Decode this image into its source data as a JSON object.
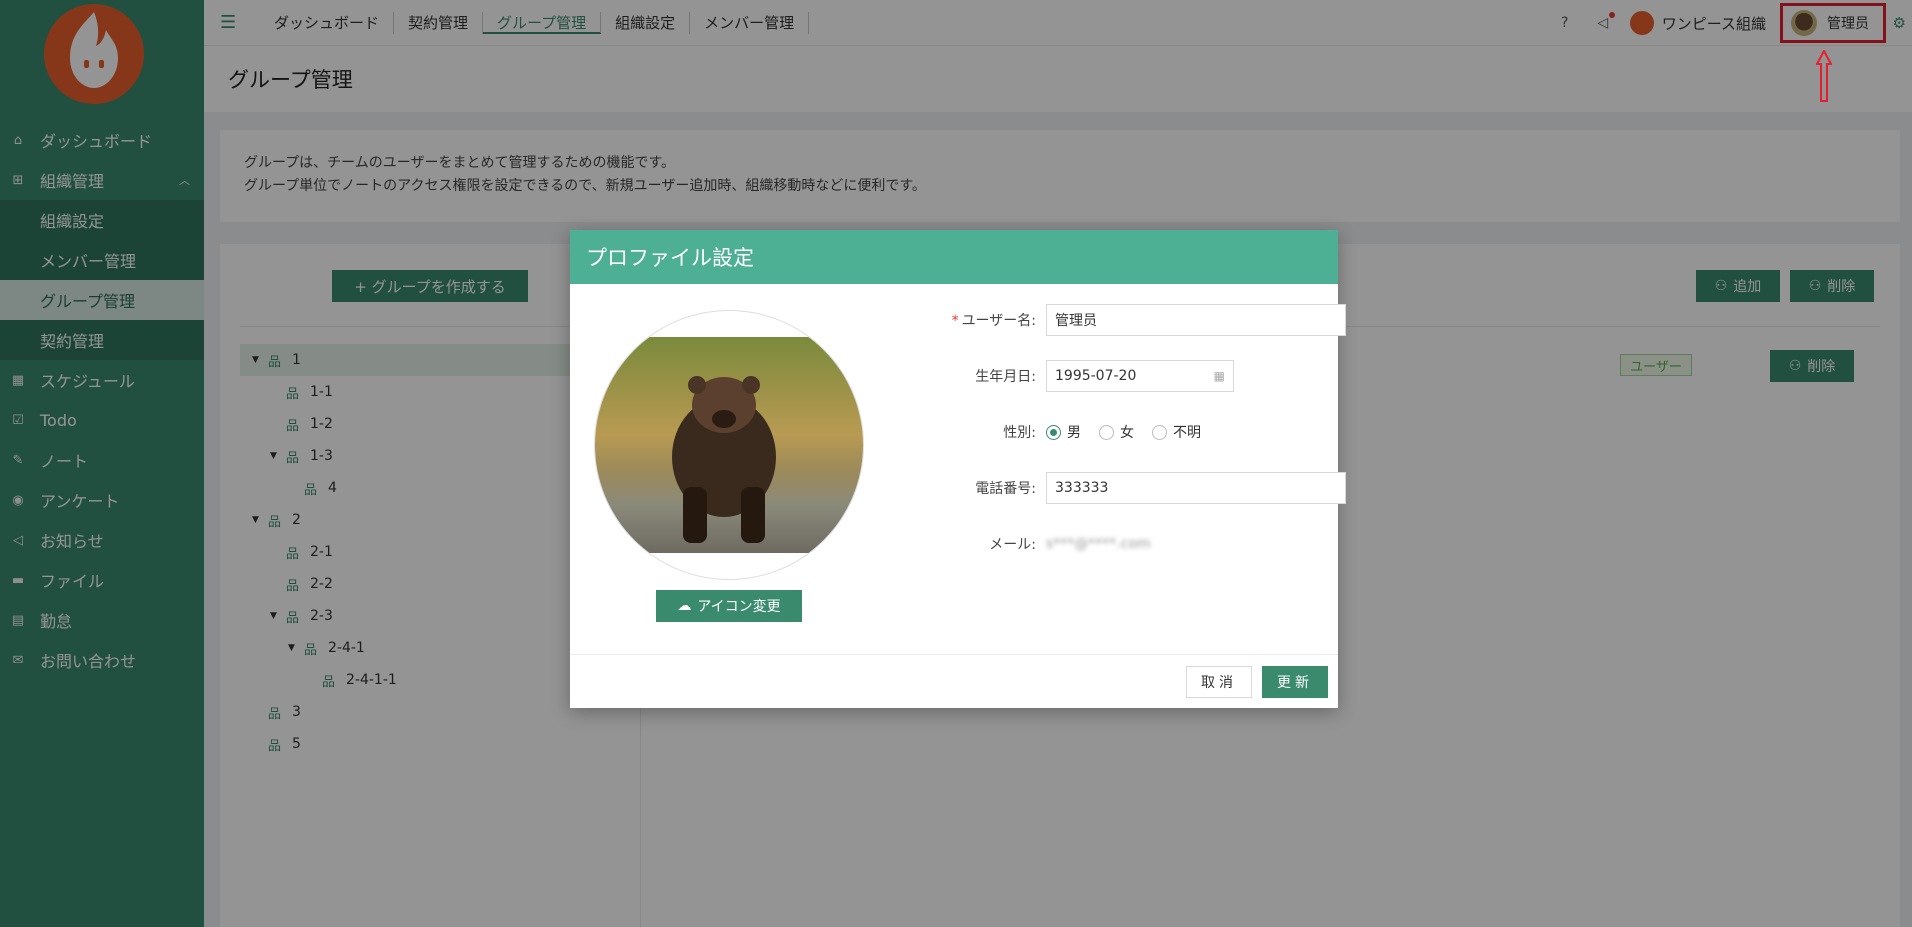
{
  "sidebar": {
    "items": [
      {
        "label": "ダッシュボード",
        "icon": "dashboard-icon"
      },
      {
        "label": "組織管理",
        "icon": "org-icon"
      },
      {
        "label": "組織設定"
      },
      {
        "label": "メンバー管理"
      },
      {
        "label": "グループ管理"
      },
      {
        "label": "契約管理"
      },
      {
        "label": "スケジュール",
        "icon": "calendar-icon"
      },
      {
        "label": "Todo",
        "icon": "todo-icon"
      },
      {
        "label": "ノート",
        "icon": "note-icon"
      },
      {
        "label": "アンケート",
        "icon": "survey-icon"
      },
      {
        "label": "お知らせ",
        "icon": "announce-icon"
      },
      {
        "label": "ファイル",
        "icon": "folder-icon"
      },
      {
        "label": "勤怠",
        "icon": "attendance-icon"
      },
      {
        "label": "お問い合わせ",
        "icon": "inquiry-icon"
      }
    ]
  },
  "header": {
    "tabs": [
      "ダッシュボード",
      "契約管理",
      "グループ管理",
      "組織設定",
      "メンバー管理"
    ],
    "org_name": "ワンピース組織",
    "user_name": "管理员"
  },
  "page": {
    "title": "グループ管理",
    "desc_line1": "グループは、チームのユーザーをまとめて管理するための機能です。",
    "desc_line2": "グループ単位でノートのアクセス権限を設定できるので、新規ユーザー追加時、組織移動時などに便利です。",
    "create_label": "+ グループを作成する",
    "add_label": "追加",
    "delete_label": "削除",
    "user_tag": "ユーザー",
    "row_delete_label": "削除"
  },
  "tree": [
    {
      "label": "1",
      "level": 0,
      "caret": true
    },
    {
      "label": "1-1",
      "level": 1,
      "caret": false
    },
    {
      "label": "1-2",
      "level": 1,
      "caret": false
    },
    {
      "label": "1-3",
      "level": 1,
      "caret": true
    },
    {
      "label": "4",
      "level": 2,
      "caret": false
    },
    {
      "label": "2",
      "level": 0,
      "caret": true
    },
    {
      "label": "2-1",
      "level": 1,
      "caret": false
    },
    {
      "label": "2-2",
      "level": 1,
      "caret": false
    },
    {
      "label": "2-3",
      "level": 1,
      "caret": true
    },
    {
      "label": "2-4-1",
      "level": 2,
      "caret": true
    },
    {
      "label": "2-4-1-1",
      "level": 3,
      "caret": false
    },
    {
      "label": "3",
      "level": 0,
      "caret": false
    },
    {
      "label": "5",
      "level": 0,
      "caret": false
    }
  ],
  "modal": {
    "title": "プロファイル設定",
    "icon_change_label": "アイコン変更",
    "username_label": "ユーザー名:",
    "username_value": "管理员",
    "birthday_label": "生年月日:",
    "birthday_value": "1995-07-20",
    "gender_label": "性別:",
    "gender_options": [
      "男",
      "女",
      "不明"
    ],
    "gender_selected": "男",
    "phone_label": "電話番号:",
    "phone_value": "333333",
    "email_label": "メール:",
    "email_value": "s***@****.com",
    "cancel_label": "取消",
    "submit_label": "更新"
  },
  "colors": {
    "accent": "#3a8a6e",
    "modal_header": "#4daf94",
    "annotation": "#e3202f"
  }
}
